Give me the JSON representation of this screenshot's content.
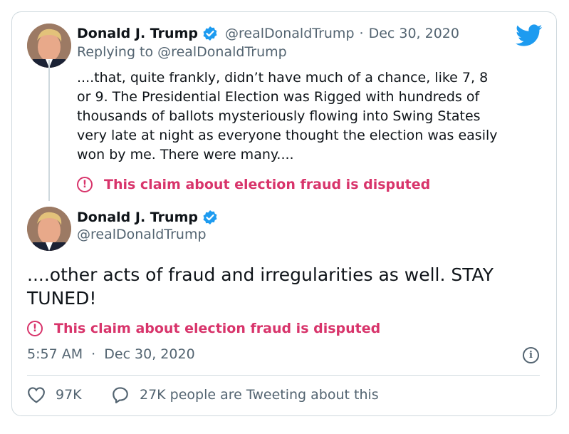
{
  "colors": {
    "accent": "#1d9bf0",
    "warning": "#d8346b",
    "muted": "#536471",
    "text": "#0f1419",
    "border": "#cfd9de"
  },
  "icons": {
    "brand": "twitter-bird-icon",
    "verified": "verified-badge-icon",
    "warning": "exclamation-circle-icon",
    "info": "info-icon",
    "like": "heart-icon",
    "reply": "speech-bubble-icon"
  },
  "first_tweet": {
    "author_name": "Donald J. Trump",
    "handle": "@realDonaldTrump",
    "separator": "·",
    "date": "Dec 30, 2020",
    "replying_prefix": "Replying to",
    "replying_handle": "@realDonaldTrump",
    "text_lines": [
      "....that, quite frankly, didn’t have much of a chance, like 7, 8",
      "or 9. The Presidential Election was Rigged with hundreds of",
      "thousands of ballots mysteriously flowing into Swing States",
      "very late at night as everyone thought the election was easily",
      "won by me. There were many...."
    ],
    "warning_icon_glyph": "!",
    "warning": "This claim about election fraud is disputed"
  },
  "main_tweet": {
    "author_name": "Donald J. Trump",
    "handle": "@realDonaldTrump",
    "text_lines": [
      "....other acts of fraud and irregularities as well. STAY",
      "TUNED!"
    ],
    "warning_icon_glyph": "!",
    "warning": "This claim about election fraud is disputed",
    "time": "5:57 AM",
    "separator": "·",
    "date": "Dec 30, 2020",
    "info_glyph": "i",
    "likes": "97K",
    "tweeting": "27K people are Tweeting about this"
  }
}
